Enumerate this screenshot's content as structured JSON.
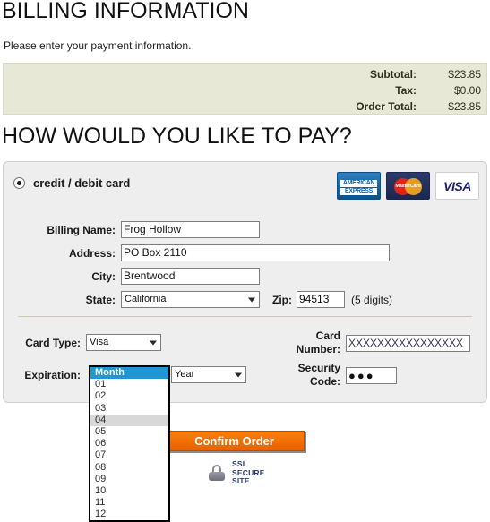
{
  "page": {
    "title": "BILLING INFORMATION",
    "intro": "Please enter your payment information."
  },
  "summary": {
    "rows": [
      {
        "label": "Subtotal:",
        "value": "$23.85"
      },
      {
        "label": "Tax:",
        "value": "$0.00"
      },
      {
        "label": "Order Total:",
        "value": "$23.85"
      }
    ]
  },
  "payment": {
    "heading": "HOW WOULD YOU LIKE TO PAY?",
    "method_label": "credit / debit card",
    "card_logos": [
      {
        "name": "american-express",
        "line1": "AMERICAN",
        "line2": "EXPRESS"
      },
      {
        "name": "mastercard",
        "text": "MasterCard"
      },
      {
        "name": "visa",
        "text": "VISA"
      }
    ],
    "fields": {
      "billing_name": {
        "label": "Billing Name:",
        "value": "Frog Hollow"
      },
      "address": {
        "label": "Address:",
        "value": "PO Box 2110"
      },
      "city": {
        "label": "City:",
        "value": "Brentwood"
      },
      "state": {
        "label": "State:",
        "value": "California"
      },
      "zip": {
        "label": "Zip:",
        "value": "94513",
        "hint": "(5 digits)"
      },
      "card_type": {
        "label": "Card Type:",
        "value": "Visa"
      },
      "expiration": {
        "label": "Expiration:",
        "month_value": "Month",
        "year_value": "Year"
      },
      "card_number": {
        "label_line1": "Card",
        "label_line2": "Number:",
        "value": "XXXXXXXXXXXXXXXX"
      },
      "security_code": {
        "label_line1": "Security",
        "label_line2": "Code:",
        "value": "●●●"
      }
    },
    "month_dropdown": {
      "open": true,
      "selected": "Month",
      "highlighted": "04",
      "options": [
        "Month",
        "01",
        "02",
        "03",
        "04",
        "05",
        "06",
        "07",
        "08",
        "09",
        "10",
        "11",
        "12"
      ]
    }
  },
  "actions": {
    "confirm_label": "Confirm Order"
  },
  "ssl": {
    "line1": "SSL",
    "line2": "SECURE",
    "line3": "SITE"
  },
  "colors": {
    "summary_bg": "#e7e8d5",
    "panel_bg": "#eeeeee",
    "accent_orange": "#f26f00",
    "select_blue": "#2196d4",
    "hover_gray": "#d8d8d8",
    "ssl_navy": "#2b3b6b"
  }
}
